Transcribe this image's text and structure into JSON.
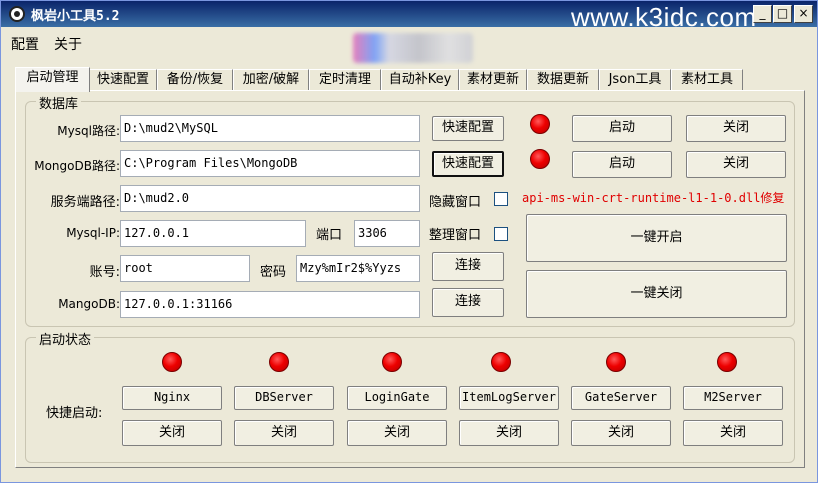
{
  "window": {
    "title": "枫岩小工具5.2",
    "watermark": "www.k3idc.com",
    "controls": {
      "minimize": "_",
      "maximize": "□",
      "close": "×"
    }
  },
  "menu": [
    "配置",
    "关于"
  ],
  "tabs": [
    "启动管理",
    "快速配置",
    "备份/恢复",
    "加密/破解",
    "定时清理",
    "自动补Key",
    "素材更新",
    "数据更新",
    "Json工具",
    "素材工具"
  ],
  "database": {
    "title": "数据库",
    "mysql_path": {
      "label": "Mysql路径:",
      "value": "D:\\mud2\\MySQL"
    },
    "mongodb_path": {
      "label": "MongoDB路径:",
      "value": "C:\\Program Files\\MongoDB"
    },
    "server_path": {
      "label": "服务端路径:",
      "value": "D:\\mud2.0"
    },
    "mysql_ip": {
      "label": "Mysql-IP:",
      "value": "127.0.0.1"
    },
    "port": {
      "label": "端口",
      "value": "3306"
    },
    "account": {
      "label": "账号:",
      "value": "root"
    },
    "password": {
      "label": "密码",
      "value": "Mzy%mIr2$%Yyzs"
    },
    "mangodb": {
      "label": "MangoDB:",
      "value": "127.0.0.1:31166"
    },
    "quick_config_1": "快速配置",
    "quick_config_2": "快速配置",
    "hide_window": "隐藏窗口",
    "organize_window": "整理窗口",
    "connect_1": "连接",
    "connect_2": "连接",
    "mysql_start": "启动",
    "mysql_stop": "关闭",
    "mongo_start": "启动",
    "mongo_stop": "关闭",
    "dll_fix": "api-ms-win-crt-runtime-l1-1-0.dll修复",
    "one_key_start": "一键开启",
    "one_key_stop": "一键关闭",
    "colors": {
      "led": "#ee0000",
      "warn": "#e00000"
    }
  },
  "startup": {
    "title": "启动状态",
    "quick_start_label": "快捷启动:",
    "servers": [
      {
        "name": "Nginx",
        "stop": "关闭"
      },
      {
        "name": "DBServer",
        "stop": "关闭"
      },
      {
        "name": "LoginGate",
        "stop": "关闭"
      },
      {
        "name": "ItemLogServer",
        "stop": "关闭"
      },
      {
        "name": "GateServer",
        "stop": "关闭"
      },
      {
        "name": "M2Server",
        "stop": "关闭"
      }
    ]
  }
}
